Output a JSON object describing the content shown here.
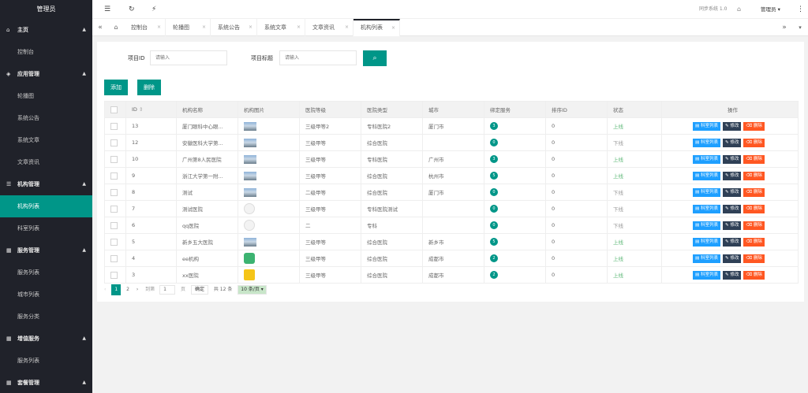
{
  "sidebar": {
    "title": "管理员",
    "groups": [
      {
        "label": "主页",
        "icon": "home-icon",
        "items": [
          "控制台"
        ]
      },
      {
        "label": "应用管理",
        "icon": "layers-icon",
        "items": [
          "轮播图",
          "系统公告",
          "系统文章",
          "文章资讯"
        ]
      },
      {
        "label": "机构管理",
        "icon": "list-icon",
        "items": [
          "机构列表",
          "科室列表"
        ]
      },
      {
        "label": "服务管理",
        "icon": "grid-icon",
        "items": [
          "服务列表",
          "城市列表",
          "服务分类"
        ]
      },
      {
        "label": "增值服务",
        "icon": "grid-icon",
        "items": [
          "服务列表"
        ]
      },
      {
        "label": "套餐管理",
        "icon": "grid-icon",
        "items": []
      }
    ],
    "active_item": "机构列表"
  },
  "topbar": {
    "menu_icon": "menu-toggle-icon",
    "refresh_icon": "refresh-icon",
    "clean_icon": "broom-icon",
    "system_version": "同步系统 1.0",
    "tag_icon": "tag-icon",
    "user_name": "管理员",
    "more_icon": "more-vertical-icon"
  },
  "tabs": {
    "items": [
      "控制台",
      "轮播图",
      "系统公告",
      "系统文章",
      "文章资讯",
      "机构列表"
    ],
    "active": "机构列表"
  },
  "search": {
    "id_label": "项目ID",
    "id_placeholder": "请输入",
    "title_label": "项目标题",
    "title_placeholder": "请输入"
  },
  "toolbar": {
    "add_label": "添加",
    "delete_label": "删除"
  },
  "table": {
    "headers": [
      "ID",
      "机构名称",
      "机构图片",
      "医院等级",
      "医院类型",
      "城市",
      "绑定服务",
      "排序ID",
      "状态",
      "操作"
    ],
    "rows": [
      {
        "id": "13",
        "name": "厦门眼科中心眼...",
        "img": "photo",
        "level": "三级甲等2",
        "type": "专科医院2",
        "city": "厦门市",
        "services": "3",
        "sort": "0",
        "status": "上线"
      },
      {
        "id": "12",
        "name": "安徽医科大学第...",
        "img": "photo",
        "level": "三级甲等",
        "type": "综合医院",
        "city": "",
        "services": "0",
        "sort": "0",
        "status": "下线"
      },
      {
        "id": "10",
        "name": "广州第8人民医院",
        "img": "photo",
        "level": "三级甲等",
        "type": "专科医院",
        "city": "广州市",
        "services": "3",
        "sort": "0",
        "status": "上线"
      },
      {
        "id": "9",
        "name": "浙江大学第一附...",
        "img": "photo",
        "level": "三级甲等",
        "type": "综合医院",
        "city": "杭州市",
        "services": "5",
        "sort": "0",
        "status": "上线"
      },
      {
        "id": "8",
        "name": "测试",
        "img": "photo",
        "level": "二级甲等",
        "type": "综合医院",
        "city": "厦门市",
        "services": "0",
        "sort": "0",
        "status": "下线"
      },
      {
        "id": "7",
        "name": "测试医院",
        "img": "avatar",
        "level": "三级甲等",
        "type": "专科医院测试",
        "city": "",
        "services": "0",
        "sort": "0",
        "status": "下线"
      },
      {
        "id": "6",
        "name": "qq医院",
        "img": "avatar",
        "level": "二",
        "type": "专科",
        "city": "",
        "services": "0",
        "sort": "0",
        "status": "下线"
      },
      {
        "id": "5",
        "name": "新乡五大医院",
        "img": "photo",
        "level": "三级甲等",
        "type": "综合医院",
        "city": "新乡市",
        "services": "5",
        "sort": "0",
        "status": "上线"
      },
      {
        "id": "4",
        "name": "ee机构",
        "img": "green-logo",
        "level": "三级甲等",
        "type": "综合医院",
        "city": "成都市",
        "services": "2",
        "sort": "0",
        "status": "上线"
      },
      {
        "id": "3",
        "name": "xx医院",
        "img": "yellow-logo",
        "level": "三级甲等",
        "type": "综合医院",
        "city": "成都市",
        "services": "2",
        "sort": "0",
        "status": "上线"
      }
    ],
    "actions": [
      "科室列表",
      "修改",
      "删除"
    ]
  },
  "pagination": {
    "pages": [
      "1",
      "2"
    ],
    "current": "1",
    "goto_label": "到第",
    "goto_value": "1",
    "page_suffix": "页",
    "confirm_label": "确定",
    "total": "共 12 条",
    "page_size": "10 条/页"
  },
  "colors": {
    "sidebar_bg": "#20222a",
    "accent": "#009688",
    "online": "#5fb878",
    "blue_btn": "#1e9fff",
    "dark_btn": "#2f4056",
    "red_btn": "#ff5722"
  }
}
